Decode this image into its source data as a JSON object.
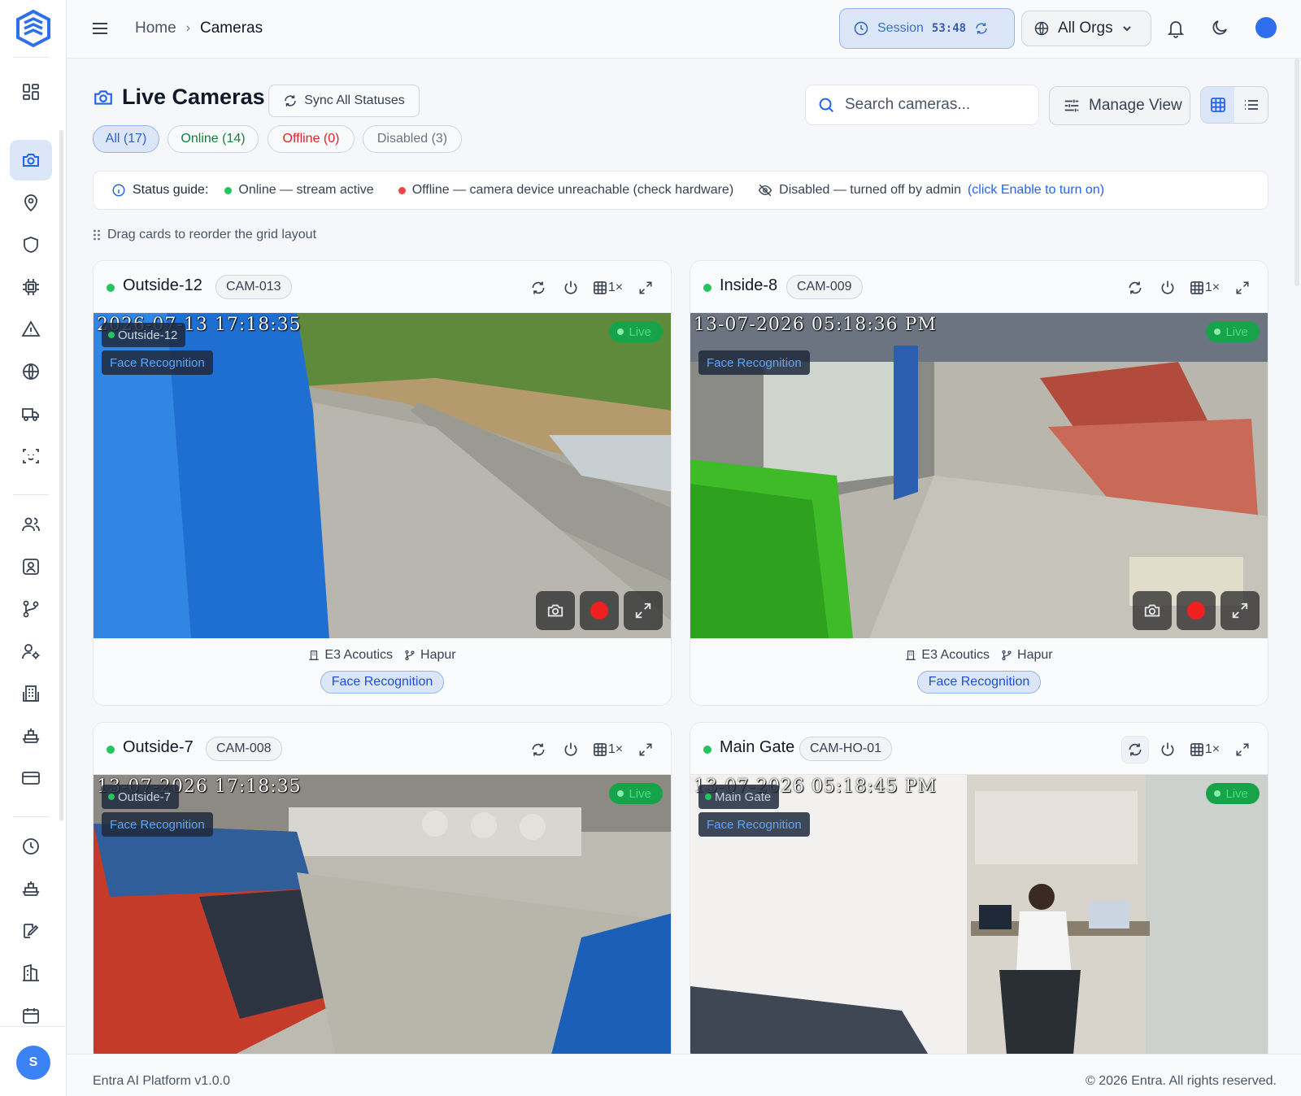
{
  "topbar": {
    "breadcrumb_home": "Home",
    "breadcrumb_sep": "›",
    "breadcrumb_current": "Cameras",
    "session_label": "Session",
    "session_time": "53:48",
    "org_selector": "All Orgs"
  },
  "page": {
    "title": "Live Cameras",
    "sync_button": "Sync All Statuses",
    "filters": {
      "all": "All (17)",
      "online": "Online (14)",
      "offline": "Offline (0)",
      "disabled": "Disabled (3)"
    },
    "search_placeholder": "Search cameras...",
    "manage_view": "Manage View",
    "guide": {
      "label": "Status guide:",
      "online": "Online — stream active",
      "offline": "Offline — camera device unreachable (check hardware)",
      "disabled": "Disabled — turned off by admin",
      "enable_link": "(click Enable to turn on)"
    },
    "drag_hint": "Drag cards to reorder the grid layout"
  },
  "cameras": [
    {
      "name": "Outside-12",
      "id": "CAM-013",
      "zoom": "1×",
      "timestamp": "2026-07-13 17:18:35",
      "overlay_name": "Outside-12",
      "overlay_tag": "Face Recognition",
      "live": "Live",
      "org": "E3 Acoutics",
      "branch": "Hapur",
      "feature": "Face Recognition"
    },
    {
      "name": "Inside-8",
      "id": "CAM-009",
      "zoom": "1×",
      "timestamp": "13-07-2026 05:18:36 PM",
      "overlay_name": "",
      "overlay_tag": "Face Recognition",
      "live": "Live",
      "org": "E3 Acoutics",
      "branch": "Hapur",
      "feature": "Face Recognition"
    },
    {
      "name": "Outside-7",
      "id": "CAM-008",
      "zoom": "1×",
      "timestamp": "13-07-2026 17:18:35",
      "overlay_name": "Outside-7",
      "overlay_tag": "Face Recognition",
      "live": "Live"
    },
    {
      "name": "Main Gate",
      "id": "CAM-HO-01",
      "zoom": "1×",
      "timestamp": "13-07-2026 05:18:45 PM",
      "overlay_name": "Main Gate",
      "overlay_tag": "Face Recognition",
      "live": "Live"
    }
  ],
  "footer": {
    "version": "Entra AI Platform v1.0.0",
    "copyright": "© 2026 Entra. All rights reserved."
  },
  "user": {
    "initial": "S"
  },
  "colors": {
    "accent": "#2563eb",
    "online": "#22c55e",
    "offline": "#ef4444",
    "live_badge": "#16a34a"
  },
  "sidebar_icons": [
    "dashboard-icon",
    "camera-icon",
    "location-pin-icon",
    "shield-icon",
    "chip-icon",
    "alert-triangle-icon",
    "globe-icon",
    "truck-icon",
    "face-scan-icon",
    "users-icon",
    "contact-icon",
    "branch-icon",
    "user-settings-icon",
    "building-icon",
    "ship-icon",
    "card-icon",
    "clock-icon",
    "ship-icon",
    "edit-icon",
    "library-icon",
    "calendar-icon"
  ]
}
